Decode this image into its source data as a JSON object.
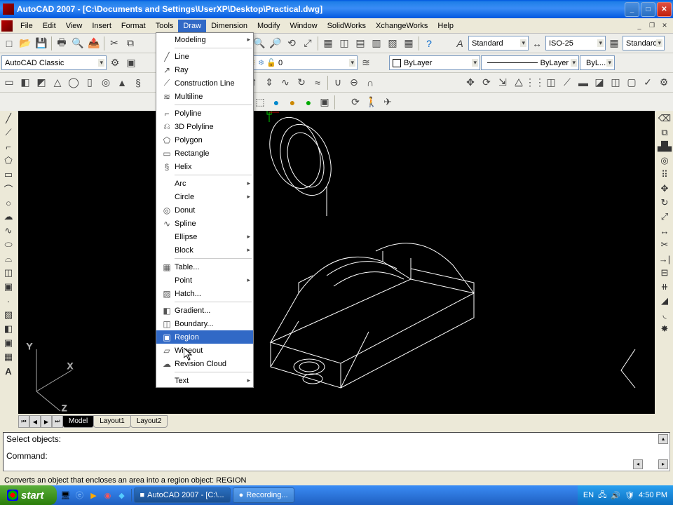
{
  "titlebar": {
    "title": "AutoCAD 2007 - [C:\\Documents and Settings\\UserXP\\Desktop\\Practical.dwg]"
  },
  "menubar": {
    "items": [
      "File",
      "Edit",
      "View",
      "Insert",
      "Format",
      "Tools",
      "Draw",
      "Dimension",
      "Modify",
      "Window",
      "SolidWorks",
      "XchangeWorks",
      "Help"
    ],
    "active_index": 6
  },
  "workspace_selector": "AutoCAD Classic",
  "text_style_selector": "Standard",
  "dim_style_selector": "ISO-25",
  "table_style_selector": "Standard",
  "layer_selector": "0",
  "color_selector": "ByLayer",
  "linetype_selector": "ByLayer",
  "lineweight_selector": "ByL...",
  "model_tabs": {
    "tabs": [
      "Model",
      "Layout1",
      "Layout2"
    ],
    "active": 0
  },
  "command_area": {
    "history": "Select objects:",
    "prompt": "Command:"
  },
  "status_hint": "Converts an object that encloses an area into a region object:  REGION",
  "draw_menu": {
    "sections": [
      [
        {
          "label": "Modeling",
          "icon": "",
          "sub": true
        }
      ],
      [
        {
          "label": "Line",
          "icon": "╱"
        },
        {
          "label": "Ray",
          "icon": "↗"
        },
        {
          "label": "Construction Line",
          "icon": "⟋"
        },
        {
          "label": "Multiline",
          "icon": "≋"
        }
      ],
      [
        {
          "label": "Polyline",
          "icon": "⌐"
        },
        {
          "label": "3D Polyline",
          "icon": "⎌"
        },
        {
          "label": "Polygon",
          "icon": "⬠"
        },
        {
          "label": "Rectangle",
          "icon": "▭"
        },
        {
          "label": "Helix",
          "icon": "§"
        }
      ],
      [
        {
          "label": "Arc",
          "icon": "",
          "sub": true
        },
        {
          "label": "Circle",
          "icon": "",
          "sub": true
        },
        {
          "label": "Donut",
          "icon": "◎"
        },
        {
          "label": "Spline",
          "icon": "∿"
        },
        {
          "label": "Ellipse",
          "icon": "",
          "sub": true
        },
        {
          "label": "Block",
          "icon": "",
          "sub": true
        }
      ],
      [
        {
          "label": "Table...",
          "icon": "▦"
        },
        {
          "label": "Point",
          "icon": "",
          "sub": true
        },
        {
          "label": "Hatch...",
          "icon": "▨"
        }
      ],
      [
        {
          "label": "Gradient...",
          "icon": "◧"
        },
        {
          "label": "Boundary...",
          "icon": "◫"
        },
        {
          "label": "Region",
          "icon": "▣",
          "highlighted": true
        },
        {
          "label": "Wipeout",
          "icon": "▱"
        },
        {
          "label": "Revision Cloud",
          "icon": "☁"
        }
      ],
      [
        {
          "label": "Text",
          "icon": "",
          "sub": true
        }
      ]
    ]
  },
  "taskbar": {
    "start": "start",
    "tasks": [
      {
        "label": "AutoCAD 2007 - [C:\\...",
        "active": true,
        "icon": "■"
      },
      {
        "label": "Recording...",
        "active": false,
        "icon": "●"
      }
    ],
    "tray": {
      "lang": "EN",
      "time": "4:50 PM"
    }
  },
  "ucs": {
    "x": "X",
    "y": "Y",
    "z": "Z"
  }
}
